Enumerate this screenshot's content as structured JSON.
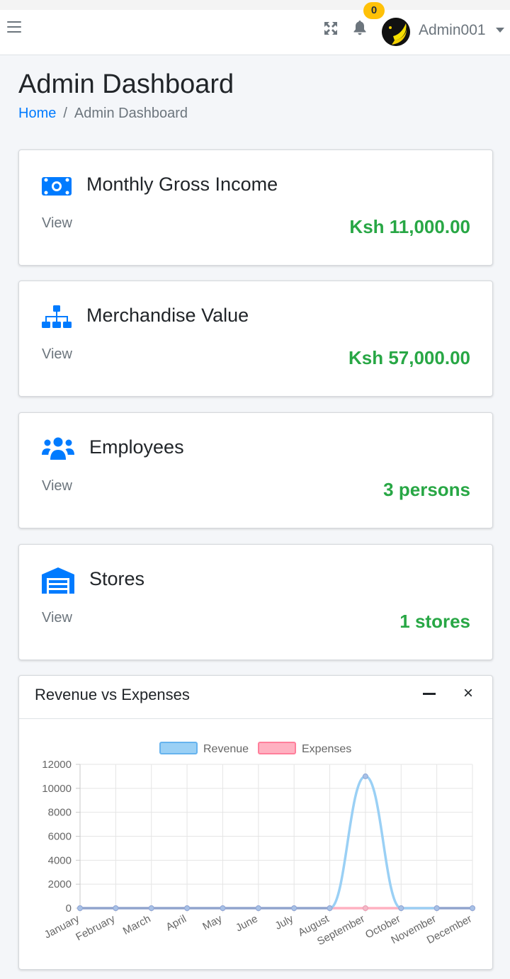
{
  "header": {
    "notification_count": "0",
    "username": "Admin001",
    "icons": [
      "menu-icon",
      "fullscreen-icon",
      "bell-icon",
      "user-avatar"
    ]
  },
  "page": {
    "title": "Admin Dashboard",
    "breadcrumb": {
      "home": "Home",
      "separator": "/",
      "current": "Admin Dashboard"
    }
  },
  "cards": [
    {
      "title": "Monthly Gross Income",
      "link": "View",
      "value": "Ksh 11,000.00",
      "icon": "money-icon"
    },
    {
      "title": "Merchandise Value",
      "link": "View",
      "value": "Ksh 57,000.00",
      "icon": "sitemap-icon"
    },
    {
      "title": "Employees",
      "link": "View",
      "value": "3 persons",
      "icon": "users-icon"
    },
    {
      "title": "Stores",
      "link": "View",
      "value": "1 stores",
      "icon": "warehouse-icon"
    }
  ],
  "colors": {
    "accent": "#007bff",
    "value_green": "#28a745",
    "badge": "#ffc107",
    "revenue": "#9ad0f5",
    "expenses": "#ffb1c1"
  },
  "chart_panel": {
    "title": "Revenue vs Expenses",
    "minimize_label": "–",
    "close_label": "×"
  },
  "chart_data": {
    "type": "line",
    "categories": [
      "January",
      "February",
      "March",
      "April",
      "May",
      "June",
      "July",
      "August",
      "September",
      "October",
      "November",
      "December"
    ],
    "series": [
      {
        "name": "Revenue",
        "values": [
          0,
          0,
          0,
          0,
          0,
          0,
          0,
          0,
          11000,
          0,
          0,
          0
        ],
        "color": "#9ad0f5"
      },
      {
        "name": "Expenses",
        "values": [
          0,
          0,
          0,
          0,
          0,
          0,
          0,
          0,
          0,
          0,
          0,
          0
        ],
        "color": "#ffb1c1"
      }
    ],
    "ylim": [
      0,
      12000
    ],
    "yticks": [
      0,
      2000,
      4000,
      6000,
      8000,
      10000,
      12000
    ],
    "grid": true,
    "legend": "top"
  }
}
